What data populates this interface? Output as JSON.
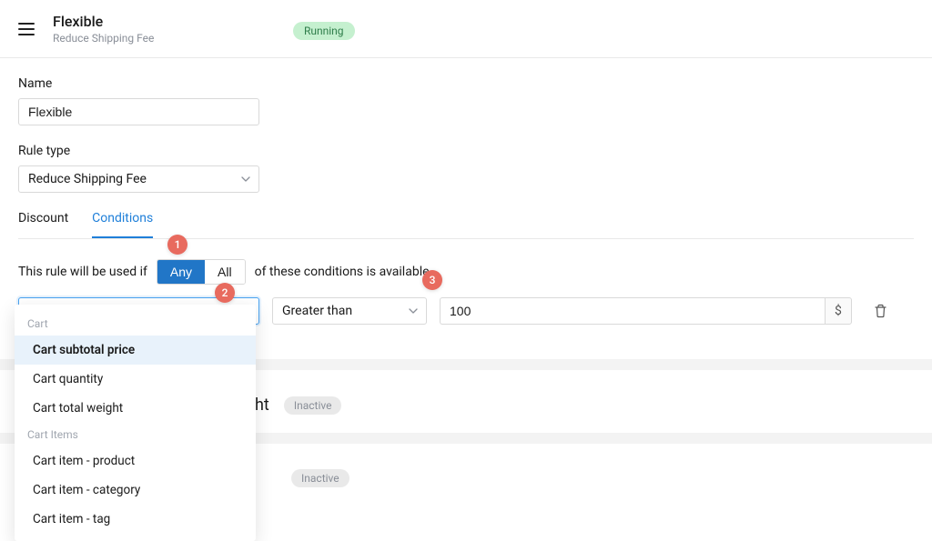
{
  "header": {
    "title": "Flexible",
    "subtitle": "Reduce Shipping Fee",
    "status_label": "Running"
  },
  "form": {
    "name_label": "Name",
    "name_value": "Flexible",
    "rule_type_label": "Rule type",
    "rule_type_value": "Reduce Shipping Fee"
  },
  "tabs": {
    "discount": "Discount",
    "conditions": "Conditions"
  },
  "condition_sentence": {
    "prefix": "This rule will be used if",
    "any": "Any",
    "all": "All",
    "suffix": "of these conditions is available."
  },
  "condition": {
    "field_placeholder": "Cart subtotal price",
    "operator_value": "Greater than",
    "value": "100",
    "unit": "$"
  },
  "dropdown": {
    "group_cart": "Cart",
    "group_cart_items": "Cart Items",
    "opt_cart_subtotal": "Cart subtotal price",
    "opt_cart_quantity": "Cart quantity",
    "opt_cart_weight": "Cart total weight",
    "opt_item_product": "Cart item - product",
    "opt_item_category": "Cart item - category",
    "opt_item_tag": "Cart item - tag"
  },
  "hints": {
    "one": "1",
    "two": "2",
    "three": "3"
  },
  "background_sections": {
    "section_a_fragment": "ht",
    "inactive_label": "Inactive"
  }
}
